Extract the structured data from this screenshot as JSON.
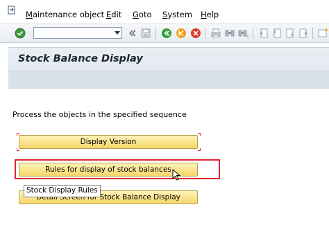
{
  "menubar": {
    "items": [
      {
        "label": "Maintenance object",
        "accel": "M",
        "rest": "aintenance object"
      },
      {
        "label": "Edit",
        "accel": "E",
        "rest": "dit"
      },
      {
        "label": "Goto",
        "accel": "G",
        "rest": "oto"
      },
      {
        "label": "System",
        "accel": "S",
        "rest": "ystem"
      },
      {
        "label": "Help",
        "accel": "H",
        "rest": "elp"
      }
    ]
  },
  "toolbar": {
    "command_field_value": "",
    "icons": [
      "enter-icon",
      "command-field-dropdown",
      "collapse-icon",
      "save-icon",
      "back-icon",
      "exit-icon",
      "cancel-icon",
      "print-icon",
      "find-icon",
      "find-next-icon",
      "first-page-icon",
      "previous-page-icon",
      "next-page-icon",
      "last-page-icon",
      "create-session-icon"
    ]
  },
  "header": {
    "title": "Stock Balance Display"
  },
  "main": {
    "instruction": "Process the objects in the specified sequence",
    "buttons": [
      {
        "label": "Display Version"
      },
      {
        "label": "Rules for display of stock balances"
      },
      {
        "label": "Detail Screen for Stock Balance Display"
      }
    ],
    "tooltip": "Stock Display Rules"
  },
  "colors": {
    "button_bg": "#f5d66a",
    "highlight": "#e0252f",
    "title_bg": "#e9eef3",
    "enter_green": "#3a9a3a"
  }
}
